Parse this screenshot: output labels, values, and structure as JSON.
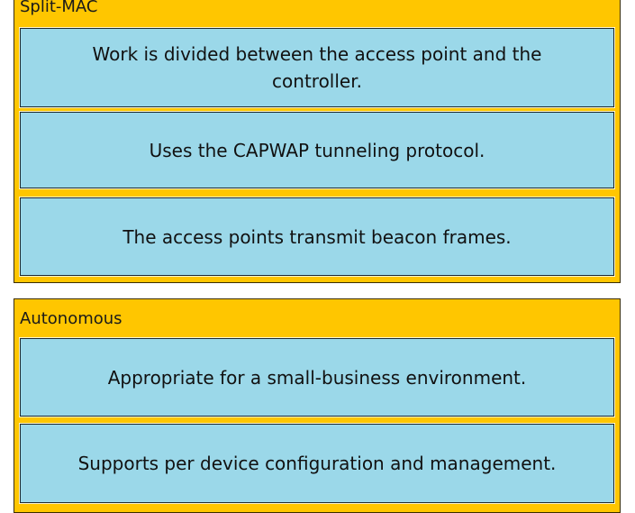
{
  "groups": [
    {
      "title": "Split-MAC",
      "items": [
        "Work is divided between the access point and the controller.",
        "Uses the CAPWAP tunneling protocol.",
        "The access points transmit beacon frames."
      ]
    },
    {
      "title": "Autonomous",
      "items": [
        "Appropriate for a small-business environment.",
        "Supports per device configuration and management."
      ]
    }
  ],
  "colors": {
    "group_background": "#ffc600",
    "card_background": "#9bd8e9"
  }
}
